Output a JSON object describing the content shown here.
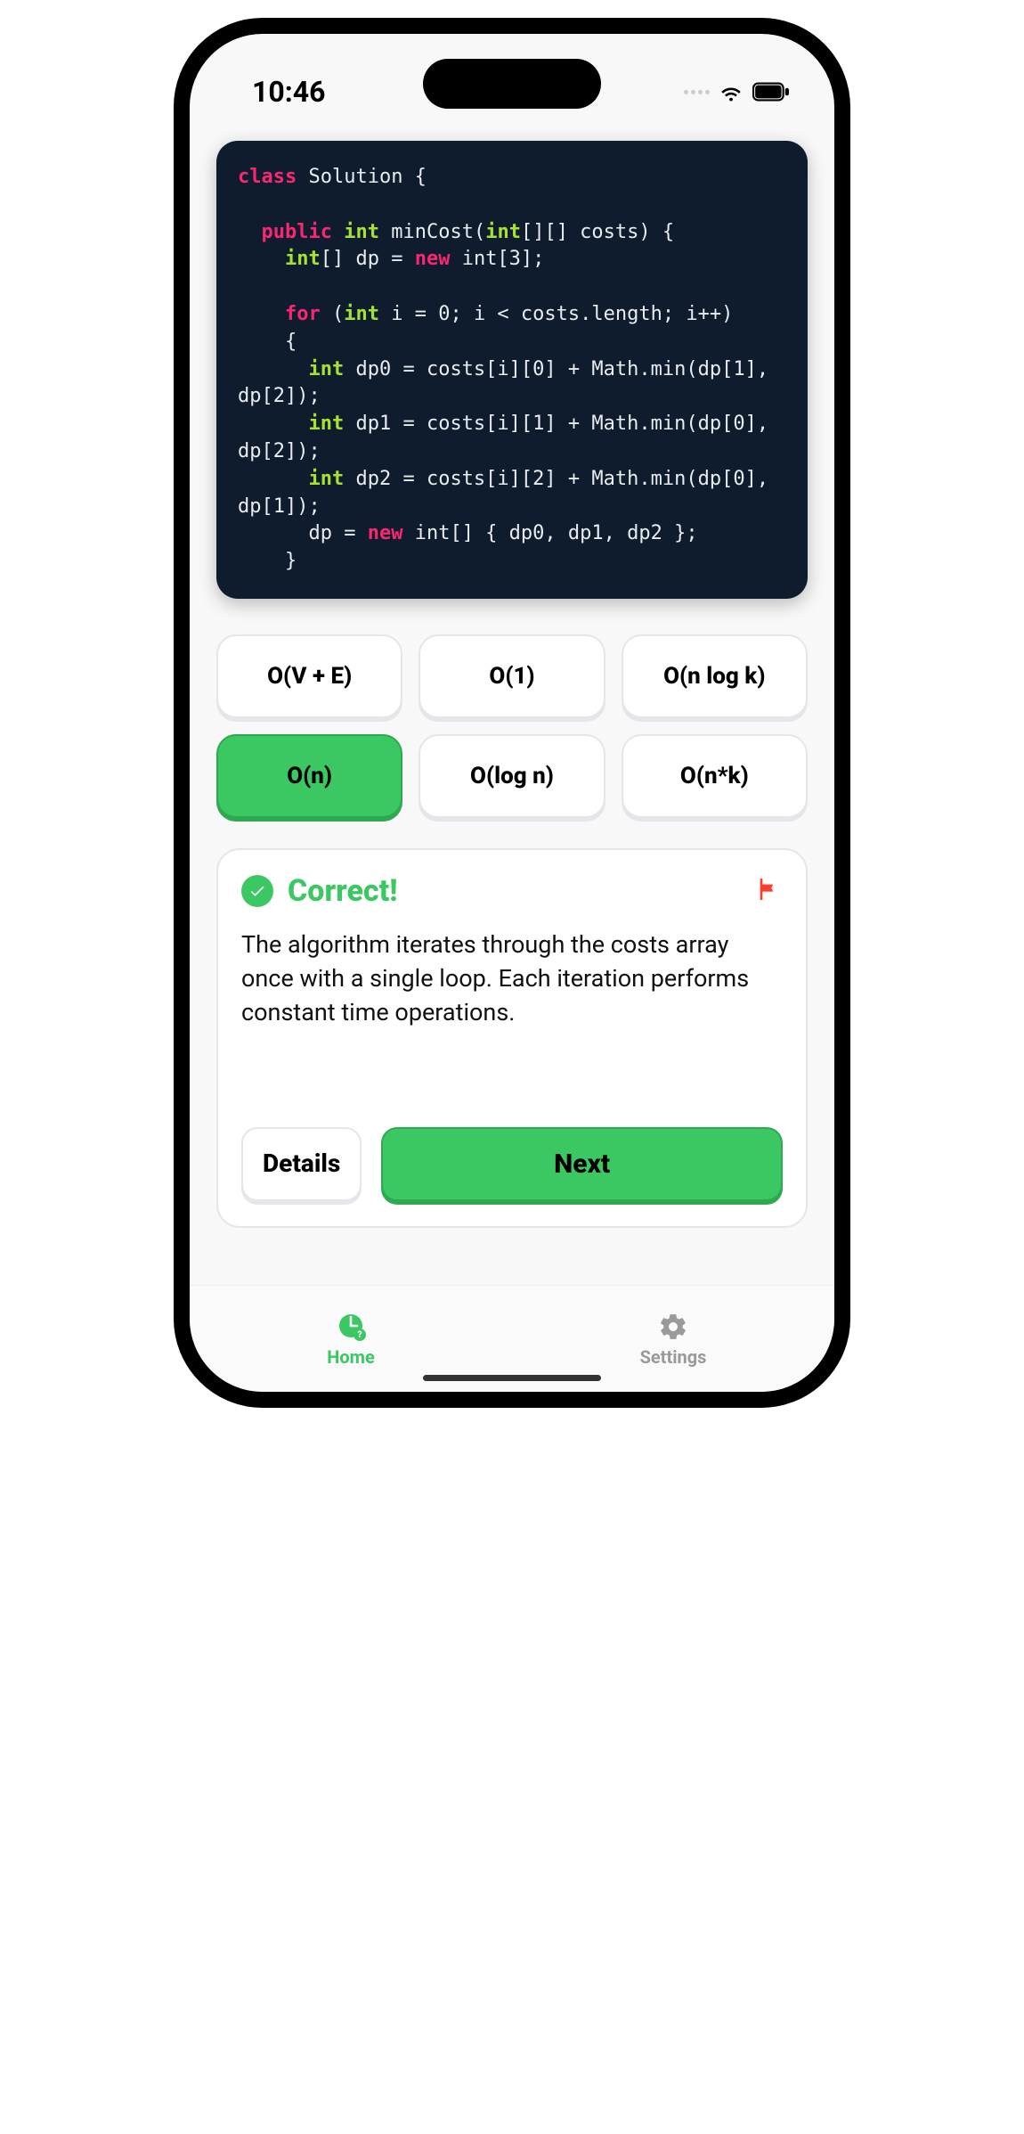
{
  "status": {
    "time": "10:46"
  },
  "code": {
    "t1": "class",
    "t2": " Solution {",
    "t3": "public",
    "t4": "int",
    "t5": " minCost(",
    "t6": "int",
    "t7": "[][] costs) {",
    "t8": "int",
    "t9": "[] dp = ",
    "t10": "new",
    "t11": " int[3];",
    "t12": "for",
    "t13": " (",
    "t14": "int",
    "t15": " i = 0; i < costs.length; i++)",
    "t16": "{",
    "t17": "int",
    "t18": " dp0 = costs[i][0] + Math.min(dp[1], dp[2]);",
    "t19": "int",
    "t20": " dp1 = costs[i][1] + Math.min(dp[0], dp[2]);",
    "t21": "int",
    "t22": " dp2 = costs[i][2] + Math.min(dp[0], dp[1]);",
    "t23": "dp = ",
    "t24": "new",
    "t25": " int[] { dp0, dp1, dp2 };",
    "t26": "}"
  },
  "options": [
    "O(V + E)",
    "O(1)",
    "O(n log k)",
    "O(n)",
    "O(log n)",
    "O(n*k)"
  ],
  "selected_index": 3,
  "result": {
    "title": "Correct!",
    "explanation": "The algorithm iterates through the costs array once with a single loop. Each iteration performs constant time operations.",
    "details_label": "Details",
    "next_label": "Next"
  },
  "tabs": {
    "home": "Home",
    "settings": "Settings"
  }
}
